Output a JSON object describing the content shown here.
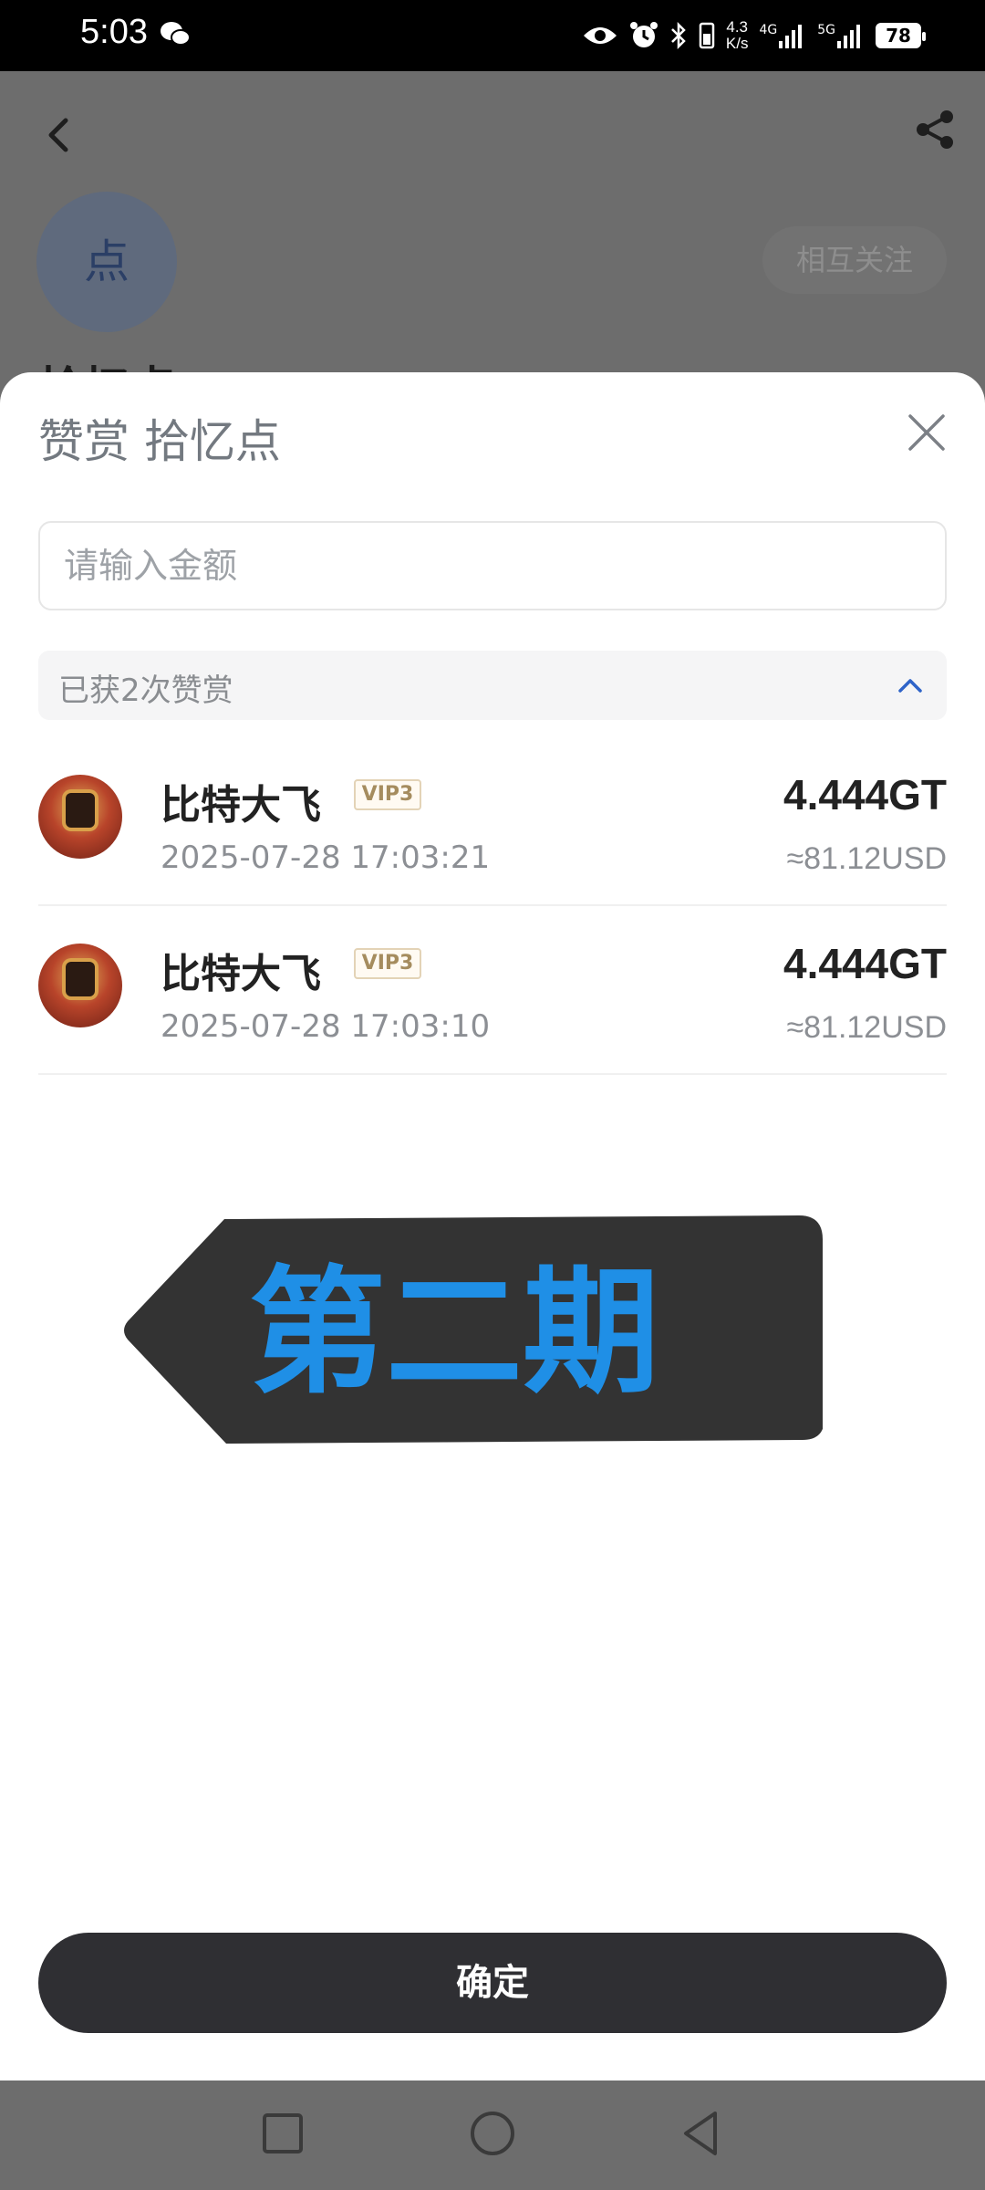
{
  "status_bar": {
    "time": "5:03",
    "net_speed_value": "4.3",
    "net_speed_unit": "K/s",
    "signal_1": "4G",
    "signal_2": "5G",
    "battery": "78"
  },
  "background_page": {
    "avatar_char": "点",
    "follow_label": "相互关注",
    "profile_name": "拾忆点"
  },
  "sheet": {
    "title": "赞赏 拾忆点",
    "amount_placeholder": "请输入金额",
    "reward_count_label": "已获2次赞赏",
    "rewards": [
      {
        "user": "比特大飞",
        "vip": "VIP3",
        "datetime": "2025-07-28 17:03:21",
        "amount": "4.444GT",
        "usd": "≈81.12USD"
      },
      {
        "user": "比特大飞",
        "vip": "VIP3",
        "datetime": "2025-07-28 17:03:10",
        "amount": "4.444GT",
        "usd": "≈81.12USD"
      }
    ],
    "confirm_label": "确定"
  },
  "overlay_banner": {
    "text": "第二期",
    "text_color": "#1f8fe6",
    "background_color": "#333333"
  },
  "nav_bar": {
    "icons": [
      "recent-apps-icon",
      "home-icon",
      "back-icon"
    ]
  }
}
